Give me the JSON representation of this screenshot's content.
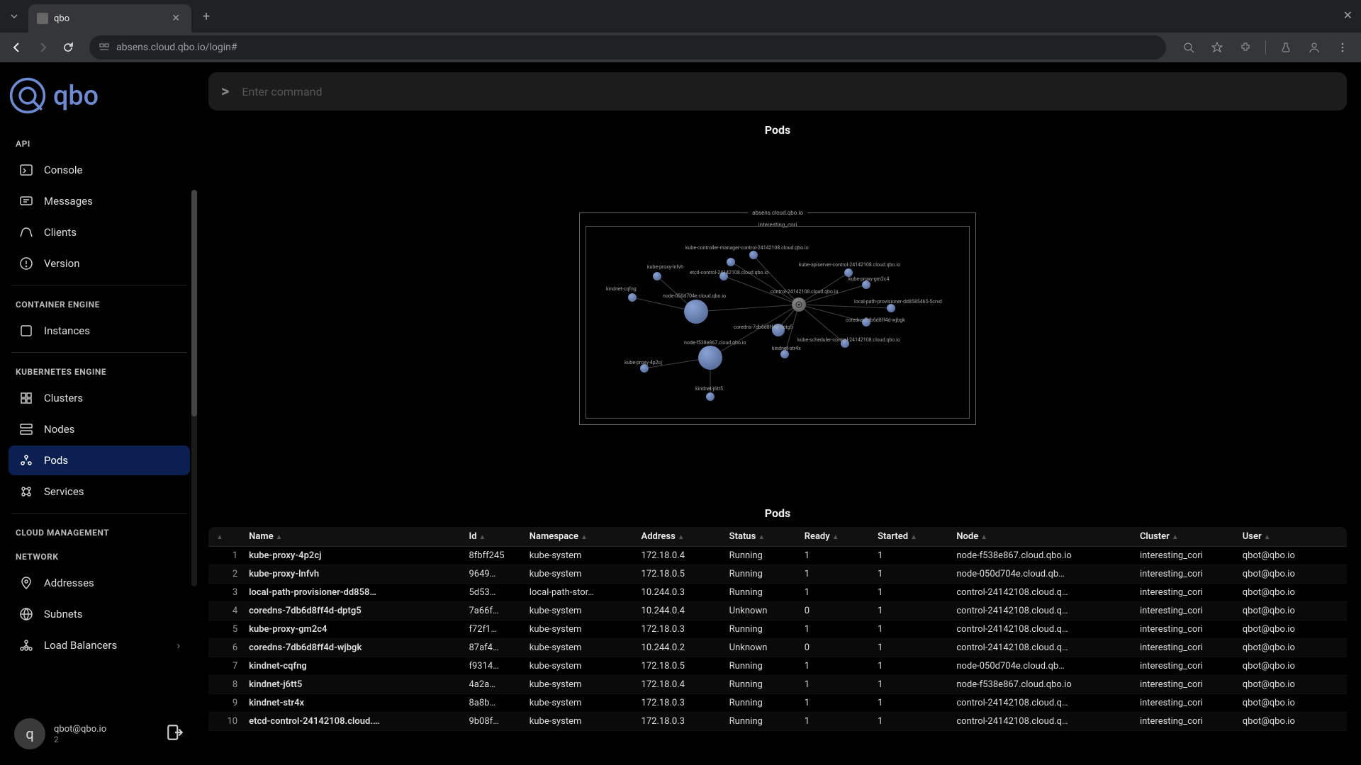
{
  "browser": {
    "tab_title": "qbo",
    "url": "absens.cloud.qbo.io/login#"
  },
  "brand": "qbo",
  "command": {
    "placeholder": "Enter command",
    "prompt": ">"
  },
  "sidebar": {
    "sections": {
      "api": "API",
      "container": "CONTAINER ENGINE",
      "k8s": "KUBERNETES ENGINE",
      "cloud": "CLOUD MANAGEMENT",
      "network": "NETWORK"
    },
    "items": {
      "console": "Console",
      "messages": "Messages",
      "clients": "Clients",
      "version": "Version",
      "instances": "Instances",
      "clusters": "Clusters",
      "nodes": "Nodes",
      "pods": "Pods",
      "services": "Services",
      "addresses": "Addresses",
      "subnets": "Subnets",
      "lbs": "Load Balancers"
    }
  },
  "user": {
    "email": "qbot@qbo.io",
    "sessions": "2",
    "avatar_letter": "q"
  },
  "panel": {
    "title": "Pods",
    "table_title": "Pods"
  },
  "graph": {
    "host": "absens.cloud.qbo.io",
    "cluster": "interesting_cori",
    "labels": [
      "kube-controller-manager-control-24142108.cloud.qbo.io",
      "kube-apiserver-control-24142108.cloud.qbo.io",
      "kube-proxy-lnfvh",
      "etcd-control-24142108.cloud.qbo.io",
      "kindnet-cqfng",
      "node-050d704e.cloud.qbo.io",
      "kube-proxy-gm2c4",
      "control-24142108.cloud.qbo.io",
      "local-path-provisioner-dd8585465-5crvd",
      "coredns-7db6d8ff4d-wjbgk",
      "coredns-7db6d8ff4d-dptg5",
      "node-f538e867.cloud.qbo.io",
      "kindnet-str4x",
      "kube-scheduler-control-24142108.cloud.qbo.io",
      "kube-proxy-4p2cj",
      "kindnet-j6tt5"
    ]
  },
  "table": {
    "headers": [
      "",
      "Name",
      "Id",
      "Namespace",
      "Address",
      "Status",
      "Ready",
      "Started",
      "Node",
      "Cluster",
      "User"
    ],
    "rows": [
      {
        "i": "1",
        "name": "kube-proxy-4p2cj",
        "id": "8fbff245",
        "ns": "kube-system",
        "addr": "172.18.0.4",
        "status": "Running",
        "ready": "1",
        "started": "1",
        "node": "node-f538e867.cloud.qbo.io",
        "cluster": "interesting_cori",
        "user": "qbot@qbo.io"
      },
      {
        "i": "2",
        "name": "kube-proxy-lnfvh",
        "id": "9649…",
        "ns": "kube-system",
        "addr": "172.18.0.5",
        "status": "Running",
        "ready": "1",
        "started": "1",
        "node": "node-050d704e.cloud.qb…",
        "cluster": "interesting_cori",
        "user": "qbot@qbo.io"
      },
      {
        "i": "3",
        "name": "local-path-provisioner-dd858…",
        "id": "5d53…",
        "ns": "local-path-stor…",
        "addr": "10.244.0.3",
        "status": "Running",
        "ready": "1",
        "started": "1",
        "node": "control-24142108.cloud.q…",
        "cluster": "interesting_cori",
        "user": "qbot@qbo.io"
      },
      {
        "i": "4",
        "name": "coredns-7db6d8ff4d-dptg5",
        "id": "7a66f…",
        "ns": "kube-system",
        "addr": "10.244.0.4",
        "status": "Unknown",
        "ready": "0",
        "started": "1",
        "node": "control-24142108.cloud.q…",
        "cluster": "interesting_cori",
        "user": "qbot@qbo.io"
      },
      {
        "i": "5",
        "name": "kube-proxy-gm2c4",
        "id": "f72f1…",
        "ns": "kube-system",
        "addr": "172.18.0.3",
        "status": "Running",
        "ready": "1",
        "started": "1",
        "node": "control-24142108.cloud.q…",
        "cluster": "interesting_cori",
        "user": "qbot@qbo.io"
      },
      {
        "i": "6",
        "name": "coredns-7db6d8ff4d-wjbgk",
        "id": "87af4…",
        "ns": "kube-system",
        "addr": "10.244.0.2",
        "status": "Unknown",
        "ready": "0",
        "started": "1",
        "node": "control-24142108.cloud.q…",
        "cluster": "interesting_cori",
        "user": "qbot@qbo.io"
      },
      {
        "i": "7",
        "name": "kindnet-cqfng",
        "id": "f9314…",
        "ns": "kube-system",
        "addr": "172.18.0.5",
        "status": "Running",
        "ready": "1",
        "started": "1",
        "node": "node-050d704e.cloud.qb…",
        "cluster": "interesting_cori",
        "user": "qbot@qbo.io"
      },
      {
        "i": "8",
        "name": "kindnet-j6tt5",
        "id": "4a2a…",
        "ns": "kube-system",
        "addr": "172.18.0.4",
        "status": "Running",
        "ready": "1",
        "started": "1",
        "node": "node-f538e867.cloud.qbo.io",
        "cluster": "interesting_cori",
        "user": "qbot@qbo.io"
      },
      {
        "i": "9",
        "name": "kindnet-str4x",
        "id": "8a8b…",
        "ns": "kube-system",
        "addr": "172.18.0.3",
        "status": "Running",
        "ready": "1",
        "started": "1",
        "node": "control-24142108.cloud.q…",
        "cluster": "interesting_cori",
        "user": "qbot@qbo.io"
      },
      {
        "i": "10",
        "name": "etcd-control-24142108.cloud.…",
        "id": "9b08f…",
        "ns": "kube-system",
        "addr": "172.18.0.3",
        "status": "Running",
        "ready": "1",
        "started": "1",
        "node": "control-24142108.cloud.q…",
        "cluster": "interesting_cori",
        "user": "qbot@qbo.io"
      }
    ]
  }
}
